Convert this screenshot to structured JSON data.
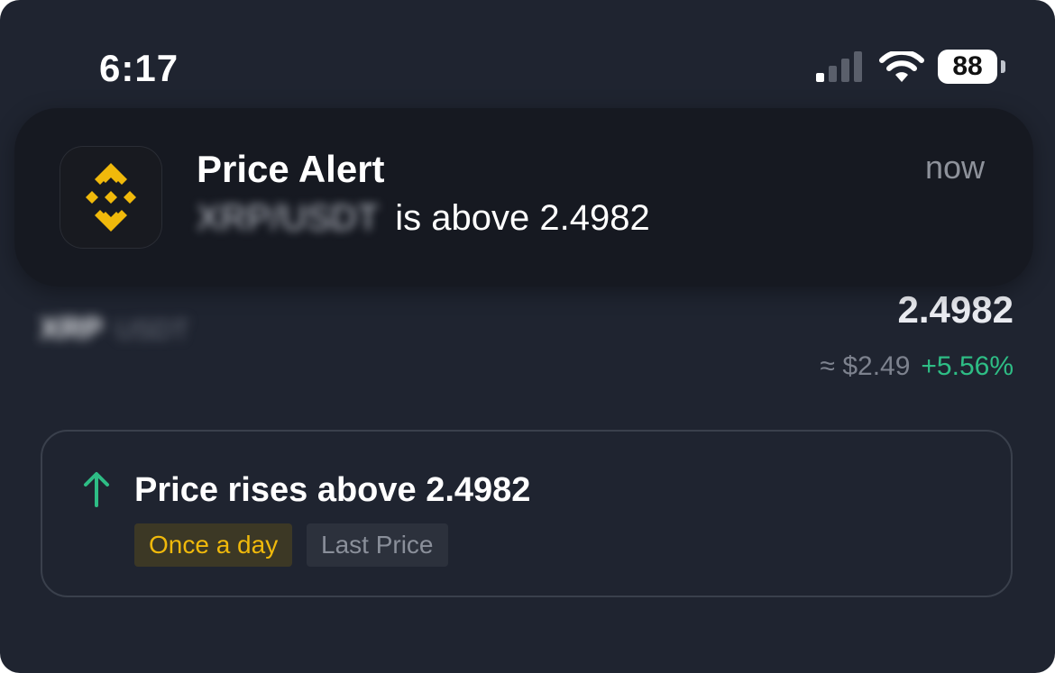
{
  "status_bar": {
    "time": "6:17",
    "battery_level": "88",
    "icons": [
      "cellular-signal-icon",
      "wifi-icon",
      "battery-icon"
    ]
  },
  "notification": {
    "app_icon": "binance-logo-icon",
    "title": "Price Alert",
    "time": "now",
    "pair": "XRP/USDT",
    "message": "is above 2.4982"
  },
  "market": {
    "pair_base": "XRP",
    "pair_quote": "USDT",
    "last_price": "2.4982",
    "fiat_price": "≈ $2.49",
    "change_pct": "+5.56%"
  },
  "alert": {
    "icon": "arrow-up-icon",
    "title": "Price rises above 2.4982",
    "frequency": "Once a day",
    "price_type": "Last Price"
  },
  "colors": {
    "background": "#1f2430",
    "accent_yellow": "#f0b90b",
    "positive_green": "#2ebd85"
  }
}
